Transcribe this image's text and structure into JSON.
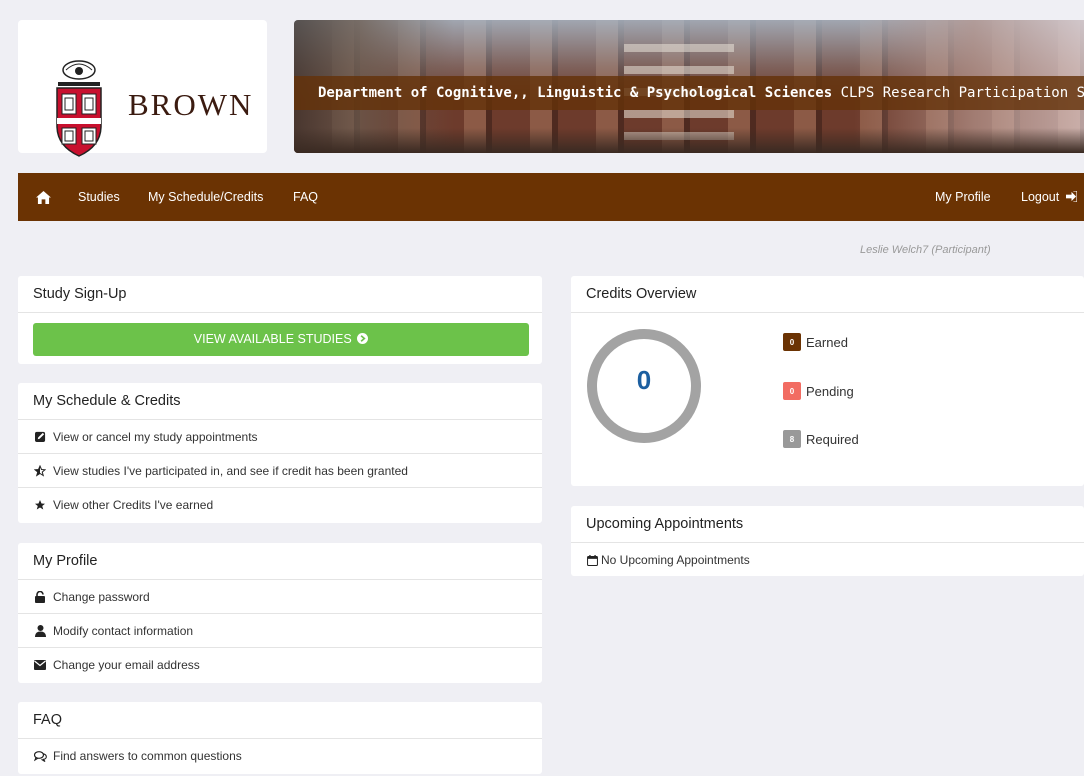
{
  "header": {
    "brand": "BROWN",
    "banner_bold": "Department of Cognitive,, Linguistic & Psychological Sciences",
    "banner_rest": " CLPS Research Participation System"
  },
  "nav": {
    "home_icon": "home-icon",
    "studies": "Studies",
    "schedule": "My Schedule/Credits",
    "faq": "FAQ",
    "profile": "My Profile",
    "logout": "Logout"
  },
  "user_line": "Leslie Welch7 (Participant)",
  "signup": {
    "title": "Study Sign-Up",
    "button": "VIEW AVAILABLE STUDIES"
  },
  "schedule": {
    "title": "My Schedule & Credits",
    "items": [
      {
        "label": "View or cancel my study appointments",
        "icon": "edit-icon"
      },
      {
        "label": "View studies I've participated in, and see if credit has been granted",
        "icon": "star-half-icon"
      },
      {
        "label": "View other Credits I've earned",
        "icon": "star-icon"
      }
    ]
  },
  "profile": {
    "title": "My Profile",
    "items": [
      {
        "label": "Change password",
        "icon": "lock-icon"
      },
      {
        "label": "Modify contact information",
        "icon": "user-icon"
      },
      {
        "label": "Change your email address",
        "icon": "envelope-icon"
      }
    ]
  },
  "faq": {
    "title": "FAQ",
    "items": [
      {
        "label": "Find answers to common questions",
        "icon": "chat-icon"
      }
    ]
  },
  "credits": {
    "title": "Credits Overview",
    "total": "0",
    "earned_count": "0",
    "earned_label": "Earned",
    "pending_count": "0",
    "pending_label": "Pending",
    "required_count": "8",
    "required_label": "Required",
    "colors": {
      "earned": "#6b3303",
      "pending": "#f26c62",
      "required": "#999999",
      "ring": "#a3a3a3",
      "number": "#1c5fa0"
    }
  },
  "appointments": {
    "title": "Upcoming Appointments",
    "empty": "No Upcoming Appointments"
  },
  "colors": {
    "navbar": "#6b3303",
    "button": "#6cc24a",
    "background": "#efeff4"
  }
}
